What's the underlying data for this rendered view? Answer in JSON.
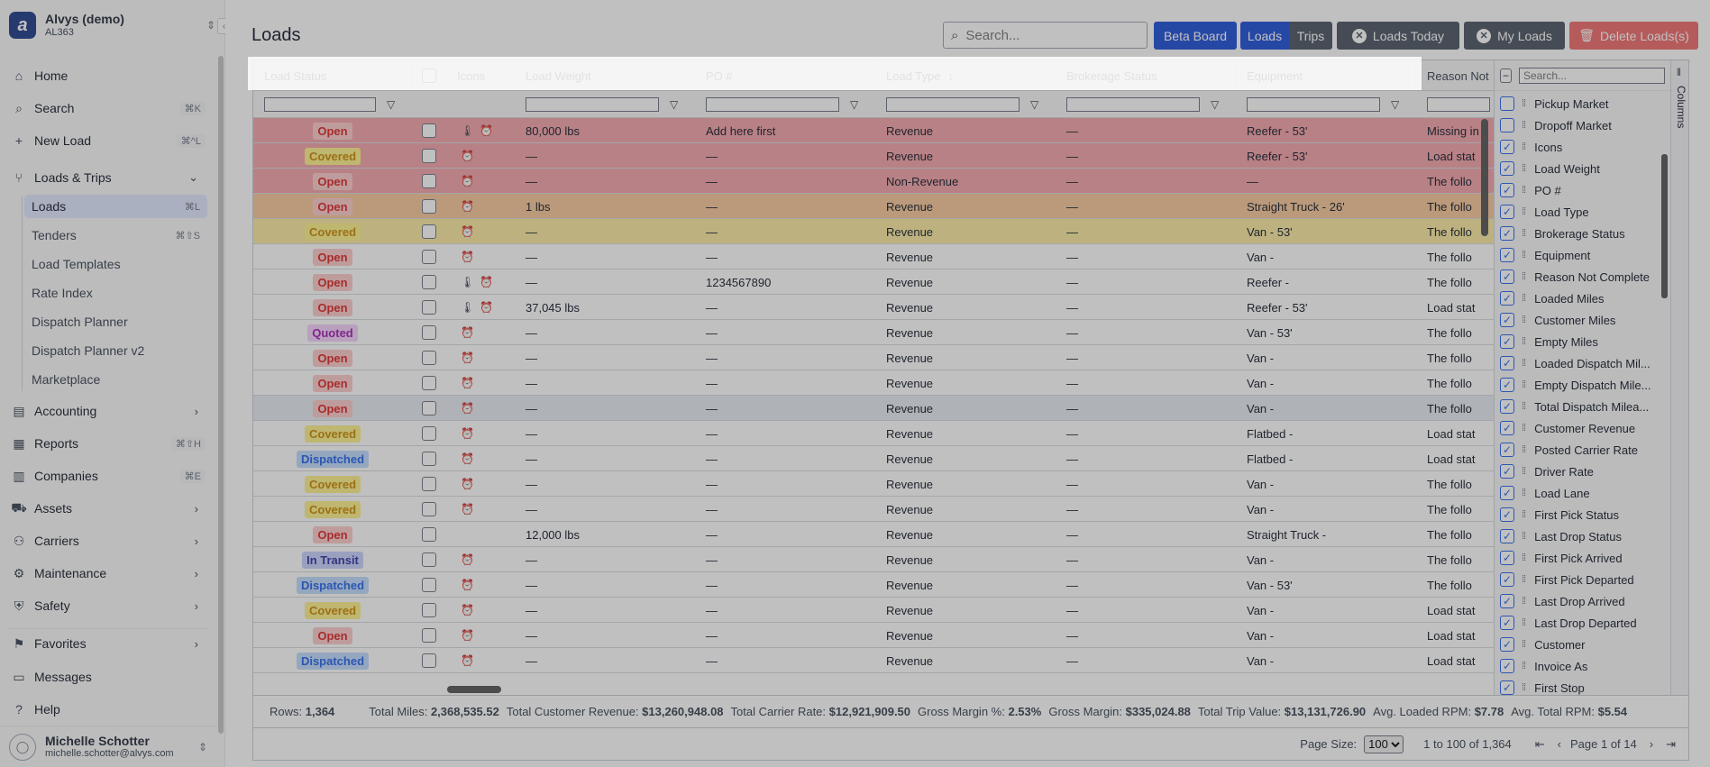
{
  "org": {
    "name": "Alvys (demo)",
    "code": "AL363",
    "logo_letter": "a"
  },
  "nav": {
    "home": "Home",
    "search": "Search",
    "search_kbd": "⌘K",
    "new_load": "New Load",
    "new_load_kbd": "⌘^L",
    "loads_trips": "Loads & Trips",
    "sub": [
      {
        "label": "Loads",
        "kbd": "⌘L"
      },
      {
        "label": "Tenders",
        "kbd": "⌘⇧S"
      },
      {
        "label": "Load Templates",
        "kbd": ""
      },
      {
        "label": "Rate Index",
        "kbd": ""
      },
      {
        "label": "Dispatch Planner",
        "kbd": ""
      },
      {
        "label": "Dispatch Planner v2",
        "kbd": ""
      },
      {
        "label": "Marketplace",
        "kbd": ""
      }
    ],
    "accounting": "Accounting",
    "reports": "Reports",
    "reports_kbd": "⌘⇧H",
    "companies": "Companies",
    "companies_kbd": "⌘E",
    "assets": "Assets",
    "carriers": "Carriers",
    "maintenance": "Maintenance",
    "safety": "Safety",
    "favorites": "Favorites",
    "messages": "Messages",
    "help": "Help"
  },
  "user": {
    "name": "Michelle Schotter",
    "email": "michelle.schotter@alvys.com"
  },
  "page": {
    "title": "Loads"
  },
  "search": {
    "placeholder": "Search..."
  },
  "toolbar": {
    "beta_board": "Beta Board",
    "loads": "Loads",
    "trips": "Trips",
    "loads_today": "Loads Today",
    "my_loads": "My Loads",
    "delete_loads": "Delete Loads(s)"
  },
  "colors": {
    "primary": "#1d4ed8",
    "gray_btn": "#4b5563",
    "danger": "#dc2626"
  },
  "columns": [
    "Load Status",
    "",
    "Icons",
    "Load Weight",
    "PO #",
    "Load Type",
    "Brokerage Status",
    "Equipment",
    "Reason Not"
  ],
  "rows": [
    {
      "status": "Open",
      "bg": "#f3a3a9",
      "therm": true,
      "alarm": true,
      "weight": "80,000 lbs",
      "po": "Add here first",
      "type": "Revenue",
      "broker": "—",
      "equip": "Reefer - 53'",
      "reason": "Missing in"
    },
    {
      "status": "Covered",
      "bg": "#f3a3a9",
      "therm": false,
      "alarm": true,
      "weight": "—",
      "po": "—",
      "type": "Revenue",
      "broker": "—",
      "equip": "Reefer - 53'",
      "reason": "Load stat"
    },
    {
      "status": "Open",
      "bg": "#f3a3a9",
      "therm": false,
      "alarm": true,
      "weight": "—",
      "po": "—",
      "type": "Non-Revenue",
      "broker": "—",
      "equip": "—",
      "reason": "The follo"
    },
    {
      "status": "Open",
      "bg": "#f7c89a",
      "therm": false,
      "alarm": true,
      "weight": "1 lbs",
      "po": "—",
      "type": "Revenue",
      "broker": "—",
      "equip": "Straight Truck - 26'",
      "reason": "The follo"
    },
    {
      "status": "Covered",
      "bg": "#fbeaa0",
      "therm": false,
      "alarm": true,
      "weight": "—",
      "po": "—",
      "type": "Revenue",
      "broker": "—",
      "equip": "Van - 53'",
      "reason": "The follo"
    },
    {
      "status": "Open",
      "bg": "#ffffff",
      "therm": false,
      "alarm": true,
      "weight": "—",
      "po": "—",
      "type": "Revenue",
      "broker": "—",
      "equip": "Van -",
      "reason": "The follo"
    },
    {
      "status": "Open",
      "bg": "#ffffff",
      "therm": true,
      "alarm": true,
      "weight": "—",
      "po": "1234567890",
      "type": "Revenue",
      "broker": "—",
      "equip": "Reefer -",
      "reason": "The follo"
    },
    {
      "status": "Open",
      "bg": "#ffffff",
      "therm": true,
      "alarm": true,
      "weight": "37,045 lbs",
      "po": "—",
      "type": "Revenue",
      "broker": "—",
      "equip": "Reefer - 53'",
      "reason": "Load stat"
    },
    {
      "status": "Quoted",
      "bg": "#ffffff",
      "therm": false,
      "alarm": true,
      "weight": "—",
      "po": "—",
      "type": "Revenue",
      "broker": "—",
      "equip": "Van - 53'",
      "reason": "The follo"
    },
    {
      "status": "Open",
      "bg": "#ffffff",
      "therm": false,
      "alarm": true,
      "weight": "—",
      "po": "—",
      "type": "Revenue",
      "broker": "—",
      "equip": "Van -",
      "reason": "The follo"
    },
    {
      "status": "Open",
      "bg": "#ffffff",
      "therm": false,
      "alarm": true,
      "weight": "—",
      "po": "—",
      "type": "Revenue",
      "broker": "—",
      "equip": "Van -",
      "reason": "The follo"
    },
    {
      "status": "Open",
      "bg": "#e6ebf1",
      "therm": false,
      "alarm": true,
      "weight": "—",
      "po": "—",
      "type": "Revenue",
      "broker": "—",
      "equip": "Van -",
      "reason": "The follo"
    },
    {
      "status": "Covered",
      "bg": "#ffffff",
      "therm": false,
      "alarm": true,
      "weight": "—",
      "po": "—",
      "type": "Revenue",
      "broker": "—",
      "equip": "Flatbed -",
      "reason": "Load stat"
    },
    {
      "status": "Dispatched",
      "bg": "#ffffff",
      "therm": false,
      "alarm": true,
      "weight": "—",
      "po": "—",
      "type": "Revenue",
      "broker": "—",
      "equip": "Flatbed -",
      "reason": "Load stat"
    },
    {
      "status": "Covered",
      "bg": "#ffffff",
      "therm": false,
      "alarm": true,
      "weight": "—",
      "po": "—",
      "type": "Revenue",
      "broker": "—",
      "equip": "Van -",
      "reason": "The follo"
    },
    {
      "status": "Covered",
      "bg": "#ffffff",
      "therm": false,
      "alarm": true,
      "weight": "—",
      "po": "—",
      "type": "Revenue",
      "broker": "—",
      "equip": "Van -",
      "reason": "The follo"
    },
    {
      "status": "Open",
      "bg": "#ffffff",
      "therm": false,
      "alarm": false,
      "weight": "12,000 lbs",
      "po": "—",
      "type": "Revenue",
      "broker": "—",
      "equip": "Straight Truck -",
      "reason": "The follo"
    },
    {
      "status": "In Transit",
      "bg": "#ffffff",
      "therm": false,
      "alarm": true,
      "weight": "—",
      "po": "—",
      "type": "Revenue",
      "broker": "—",
      "equip": "Van -",
      "reason": "The follo"
    },
    {
      "status": "Dispatched",
      "bg": "#ffffff",
      "therm": false,
      "alarm": true,
      "weight": "—",
      "po": "—",
      "type": "Revenue",
      "broker": "—",
      "equip": "Van - 53'",
      "reason": "The follo"
    },
    {
      "status": "Covered",
      "bg": "#ffffff",
      "therm": false,
      "alarm": true,
      "weight": "—",
      "po": "—",
      "type": "Revenue",
      "broker": "—",
      "equip": "Van -",
      "reason": "Load stat"
    },
    {
      "status": "Open",
      "bg": "#ffffff",
      "therm": false,
      "alarm": true,
      "weight": "—",
      "po": "—",
      "type": "Revenue",
      "broker": "—",
      "equip": "Van -",
      "reason": "Load stat"
    },
    {
      "status": "Dispatched",
      "bg": "#ffffff",
      "therm": false,
      "alarm": true,
      "weight": "—",
      "po": "—",
      "type": "Revenue",
      "broker": "—",
      "equip": "Van -",
      "reason": "Load stat"
    }
  ],
  "status_colors": {
    "Open": {
      "bg": "#fecaca",
      "fg": "#dc2626"
    },
    "Covered": {
      "bg": "#fef08a",
      "fg": "#ca8a04"
    },
    "Quoted": {
      "bg": "#f5d0fe",
      "fg": "#a21caf"
    },
    "Dispatched": {
      "bg": "#bfdbfe",
      "fg": "#2563eb"
    },
    "In Transit": {
      "bg": "#c7d2fe",
      "fg": "#3730a3"
    }
  },
  "column_panel": {
    "search_placeholder": "Search...",
    "tab_label": "Columns",
    "items": [
      {
        "label": "Pickup Market",
        "checked": false
      },
      {
        "label": "Dropoff Market",
        "checked": false
      },
      {
        "label": "Icons",
        "checked": true
      },
      {
        "label": "Load Weight",
        "checked": true
      },
      {
        "label": "PO #",
        "checked": true
      },
      {
        "label": "Load Type",
        "checked": true
      },
      {
        "label": "Brokerage Status",
        "checked": true
      },
      {
        "label": "Equipment",
        "checked": true
      },
      {
        "label": "Reason Not Complete",
        "checked": true
      },
      {
        "label": "Loaded Miles",
        "checked": true
      },
      {
        "label": "Customer Miles",
        "checked": true
      },
      {
        "label": "Empty Miles",
        "checked": true
      },
      {
        "label": "Loaded Dispatch Mil...",
        "checked": true
      },
      {
        "label": "Empty Dispatch Mile...",
        "checked": true
      },
      {
        "label": "Total Dispatch Milea...",
        "checked": true
      },
      {
        "label": "Customer Revenue",
        "checked": true
      },
      {
        "label": "Posted Carrier Rate",
        "checked": true
      },
      {
        "label": "Driver Rate",
        "checked": true
      },
      {
        "label": "Load Lane",
        "checked": true
      },
      {
        "label": "First Pick Status",
        "checked": true
      },
      {
        "label": "Last Drop Status",
        "checked": true
      },
      {
        "label": "First Pick Arrived",
        "checked": true
      },
      {
        "label": "First Pick Departed",
        "checked": true
      },
      {
        "label": "Last Drop Arrived",
        "checked": true
      },
      {
        "label": "Last Drop Departed",
        "checked": true
      },
      {
        "label": "Customer",
        "checked": true
      },
      {
        "label": "Invoice As",
        "checked": true
      },
      {
        "label": "First Stop",
        "checked": true
      }
    ]
  },
  "totals": {
    "rows_label": "Rows:",
    "rows_value": "1,364",
    "miles_label": "Total Miles:",
    "miles_value": "2,368,535.52",
    "cust_rev_label": "Total Customer Revenue:",
    "cust_rev_value": "$13,260,948.08",
    "carrier_label": "Total Carrier Rate:",
    "carrier_value": "$12,921,909.50",
    "gm_pct_label": "Gross Margin %:",
    "gm_pct_value": "2.53%",
    "gm_label": "Gross Margin:",
    "gm_value": "$335,024.88",
    "trip_label": "Total Trip Value:",
    "trip_value": "$13,131,726.90",
    "lrpm_label": "Avg. Loaded RPM:",
    "lrpm_value": "$7.78",
    "trpm_label": "Avg. Total RPM:",
    "trpm_value": "$5.54"
  },
  "pager": {
    "page_size_label": "Page Size:",
    "page_size": "100",
    "range": "1 to 100 of 1,364",
    "page_text": "Page 1 of 14"
  }
}
